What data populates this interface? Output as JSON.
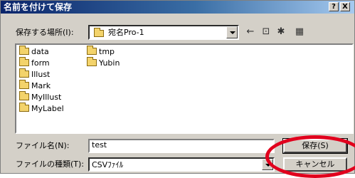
{
  "window": {
    "title": "名前を付けて保存",
    "help_label": "?",
    "close_label": "X"
  },
  "location": {
    "label": "保存する場所(I):",
    "value": "宛名Pro-1"
  },
  "toolbar": {
    "back_icon": "←",
    "up_icon": "⊡",
    "new_folder_icon": "✱",
    "view_icon": "▦"
  },
  "files": [
    "data",
    "form",
    "Illust",
    "Mark",
    "MyIllust",
    "MyLabel",
    "tmp",
    "Yubin"
  ],
  "filename": {
    "label": "ファイル名(N):",
    "value": "test"
  },
  "filetype": {
    "label": "ファイルの種類(T):",
    "value": "CSVﾌｧｲﾙ"
  },
  "buttons": {
    "save": "保存(S)",
    "cancel": "キャンセル"
  },
  "colors": {
    "highlight": "#e1001d",
    "titlebar": "#0a246a"
  }
}
